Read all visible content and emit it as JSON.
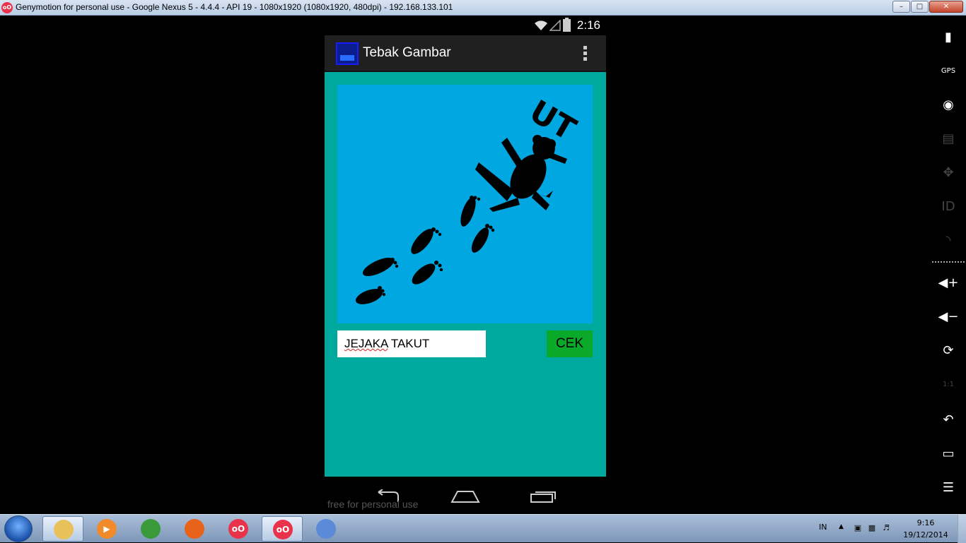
{
  "window": {
    "title": "Genymotion for personal use - Google Nexus 5 - 4.4.4 - API 19 - 1080x1920 (1080x1920, 480dpi) - 192.168.133.101",
    "app_icon": "genymotion-icon",
    "minimize_label": "–",
    "maximize_label": "□",
    "close_label": "✕"
  },
  "status_bar": {
    "time": "2:16",
    "icons": [
      "wifi-icon",
      "signal-icon",
      "battery-charging-icon"
    ]
  },
  "action_bar": {
    "title": "Tebak Gambar",
    "logo": "app-logo-icon",
    "overflow_icon": "overflow-menu-icon"
  },
  "puzzle": {
    "image_text": "UT",
    "image_description_icon": "frog-footprints-image",
    "background_color": "#00a7e1"
  },
  "answer": {
    "value_first": "JEJAKA",
    "value_rest": " TAKUT",
    "submit_label": "CEK",
    "submit_color": "#0aa92a"
  },
  "colors": {
    "content_bg": "#00a99d",
    "actionbar_bg": "#202020"
  },
  "nav_bar": {
    "icons": [
      "back-icon",
      "home-icon",
      "recent-apps-icon"
    ],
    "watermark": "free for personal use"
  },
  "genymotion_toolbar": {
    "items": [
      {
        "name": "battery-widget-icon",
        "glyph": "▮",
        "enabled": true
      },
      {
        "name": "gps-widget-icon",
        "glyph": "GPS",
        "enabled": true
      },
      {
        "name": "camera-widget-icon",
        "glyph": "◉",
        "enabled": true
      },
      {
        "name": "screencast-widget-icon",
        "glyph": "▤",
        "enabled": false
      },
      {
        "name": "remote-control-icon",
        "glyph": "✥",
        "enabled": false
      },
      {
        "name": "device-id-icon",
        "glyph": "ID",
        "enabled": false
      },
      {
        "name": "network-widget-icon",
        "glyph": "◝",
        "enabled": false
      },
      {
        "name": "volume-up-icon",
        "glyph": "◀+",
        "enabled": true
      },
      {
        "name": "volume-down-icon",
        "glyph": "◀−",
        "enabled": true
      },
      {
        "name": "rotate-icon",
        "glyph": "⟳",
        "enabled": true
      },
      {
        "name": "pixel-perfect-icon",
        "glyph": "1:1",
        "enabled": false
      },
      {
        "name": "back-icon",
        "glyph": "↶",
        "enabled": true
      },
      {
        "name": "recent-apps-icon",
        "glyph": "▭",
        "enabled": true
      },
      {
        "name": "menu-icon",
        "glyph": "☰",
        "enabled": true
      }
    ]
  },
  "taskbar": {
    "apps": [
      {
        "name": "file-explorer-icon",
        "label": "",
        "color": "#e8c15a"
      },
      {
        "name": "media-player-icon",
        "label": "▶",
        "color": "#f08a2a"
      },
      {
        "name": "chrome-icon",
        "label": "",
        "color": "#3a9a3a"
      },
      {
        "name": "firefox-icon",
        "label": "",
        "color": "#e8621a"
      },
      {
        "name": "genymotion-icon",
        "label": "oO",
        "color": "#e8334a"
      },
      {
        "name": "genymotion-device-icon",
        "label": "oO",
        "color": "#e8334a"
      },
      {
        "name": "paint-icon",
        "label": "",
        "color": "#5a8ad8"
      }
    ],
    "language": "IN",
    "time": "9:16",
    "date": "19/12/2014"
  }
}
